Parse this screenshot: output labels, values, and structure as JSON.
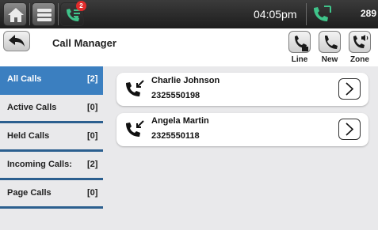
{
  "topbar": {
    "badge_count": "2",
    "time": "04:05pm",
    "number": "289"
  },
  "header": {
    "title": "Call Manager",
    "buttons": [
      {
        "label": "Line",
        "icon": "line-phone-icon"
      },
      {
        "label": "New",
        "icon": "new-call-icon"
      },
      {
        "label": "Zone",
        "icon": "zone-speaker-icon"
      }
    ]
  },
  "sidebar": {
    "items": [
      {
        "label": "All Calls",
        "count": "[2]",
        "active": true
      },
      {
        "label": "Active Calls",
        "count": "[0]",
        "active": false
      },
      {
        "label": "Held Calls",
        "count": "[0]",
        "active": false
      },
      {
        "label": "Incoming Calls:",
        "count": "[2]",
        "active": false
      },
      {
        "label": "Page Calls",
        "count": "[0]",
        "active": false
      }
    ]
  },
  "calls": [
    {
      "name": "Charlie Johnson",
      "number": "2325550198",
      "icon": "incoming-call-icon"
    },
    {
      "name": "Angela Martin",
      "number": "2325550118",
      "icon": "incoming-call-icon"
    }
  ],
  "colors": {
    "accent": "#3b7fc0",
    "divider": "#2b5f8f",
    "status_green": "#3fc48a"
  }
}
